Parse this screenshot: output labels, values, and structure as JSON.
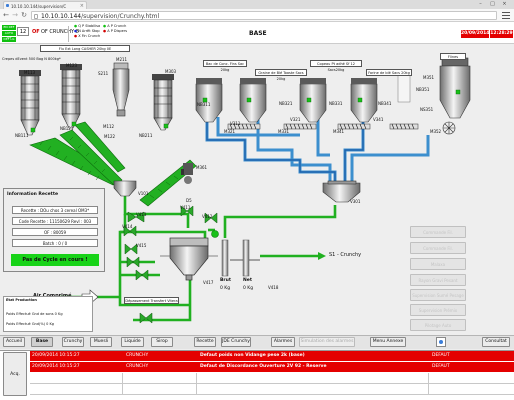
{
  "browser": {
    "tab_title": "10.10.10.144/supervision/C",
    "url_host": "10.10.10.144",
    "url_path": "/supervision/Crunchy.html",
    "back_icon": "arrow-left-icon",
    "forward_icon": "arrow-right-icon",
    "reload_icon": "reload-icon",
    "menu_icon": "menu-icon"
  },
  "header": {
    "status_small": [
      "EN DEF",
      "AUTO MN",
      "DEF LG"
    ],
    "line_num": "12",
    "of_label": "OF",
    "of_value": "OF CRUNCHY 8",
    "legend": [
      "Q P Stabilisa",
      "N Arrêt Stop",
      "X Fin Crunch",
      "A P Crunch",
      "A P Dispers"
    ],
    "page_title": "BASE",
    "date": "20/09/2014",
    "time": "12:28:29",
    "status_colors": {
      "green": "#10c010",
      "blue": "#1c2fd8",
      "red": "#d40000"
    }
  },
  "synoptic": {
    "banner": "Flu Ext Long CASHER 20kg 0E",
    "left_bin_label": "Crepes dEvent 500 Bag N 800kg*",
    "tank_labels": [
      "Bac de Conc. Fins Sac 20kg",
      "Graine de Blé Toaste Sacs 20kg",
      "Copeau Pt adhé Sf 12 Sacs20kg",
      "Farine de blé Sacs 20kg"
    ],
    "silo_tag": "Flines",
    "motors": [
      "M113",
      "M123",
      "S211",
      "M211",
      "M303",
      "M321",
      "M331",
      "M341",
      "M351"
    ],
    "fill_valves": [
      "NB111",
      "NB121",
      "NB211",
      "NB301",
      "NB311",
      "NB321",
      "NB331",
      "NB341",
      "NB351"
    ],
    "screws": [
      "V111",
      "V121",
      "V211",
      "V311",
      "V321",
      "V331",
      "V341",
      "V351"
    ],
    "misc_tags": [
      "NH111",
      "M111",
      "M112",
      "M122",
      "M113X",
      "M301",
      "NS351",
      "M352",
      "V301",
      "M361",
      "V411",
      "V412",
      "V413",
      "V414",
      "V415",
      "V416",
      "V417",
      "V418",
      "V101",
      "D5",
      "NH231"
    ],
    "tank_weight_1_label": "Brut",
    "tank_weight_1_value": "0 Kg",
    "tank_weight_2_label": "Net",
    "tank_weight_2_value": "0 Kg",
    "output": "S1 - Crunchy",
    "air_label": "Air Comprimé",
    "pipe_label": "Dépassement Transfert Vitera"
  },
  "info_recette": {
    "title": "Information Recette",
    "recette": "Recette : DOu chos 3 cereal OM3*",
    "code": "Code Recette : 11150629 Revl : 003",
    "of": "OF : 80059",
    "batch": "Batch : 0 / 0",
    "cycle_status": "Pas de Cycle en cours !"
  },
  "production": {
    "title": "Etat Production",
    "line1": "Poids Effectué Gnd de sons 0 Kg",
    "line2": "Poids Effectué Gnd(%) 0 Kg"
  },
  "right_buttons": [
    "Commande Fil.",
    "Commande Fil.",
    "Malaxa",
    "Rayon Gravi Pesant",
    "Supervision Sumé Pesage",
    "Supervision Prémix",
    "Pilotage Auto"
  ],
  "nav_buttons": [
    "Accueil",
    "Base",
    "Crunchy",
    "Muesli",
    "Liquide",
    "Sirop",
    "Recette",
    "JDE Crunchy",
    "Alarmes",
    "Simulation des alarmes",
    "Menu Annexe",
    "Consultat"
  ],
  "alarms": [
    {
      "date": "20/09/2014 10:15:27",
      "src": "CRUNCHY",
      "msg": "Defaut poids non Vidange pese 2k (base)",
      "type": "DEFAUT"
    },
    {
      "date": "20/09/2014 10:15:27",
      "src": "CRUNCHY",
      "msg": "Defaut de Discordance Ouverture 2V 92 - Reserve",
      "type": "DEFAUT"
    }
  ],
  "alarm_ack": "Acq."
}
